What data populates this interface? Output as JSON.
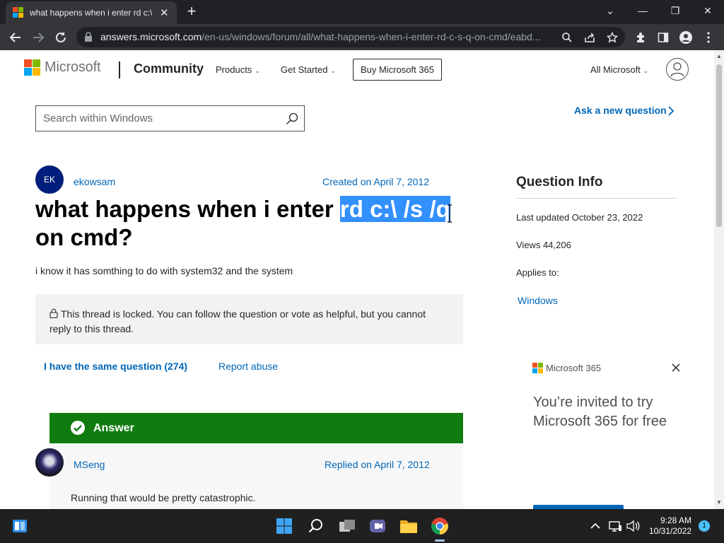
{
  "browser": {
    "tab_title": "what happens when i enter rd c:\\ /s /q on cmd",
    "tab_close": "✕",
    "new_tab": "+",
    "url_host": "answers.microsoft.com",
    "url_path": "/en-us/windows/forum/all/what-happens-when-i-enter-rd-c-s-q-on-cmd/eabd...",
    "window_controls": [
      "⌄",
      "—",
      "❐",
      "✕"
    ]
  },
  "header": {
    "brand": "Microsoft",
    "community": "Community",
    "nav": [
      "Products",
      "Get Started"
    ],
    "buy_button": "Buy Microsoft 365",
    "all_microsoft": "All Microsoft"
  },
  "search": {
    "placeholder": "Search within Windows"
  },
  "ask_question": "Ask a new question",
  "question": {
    "avatar_initials": "EK",
    "author": "ekowsam",
    "created": "Created on April 7, 2012",
    "title_before": "what happens when i enter ",
    "title_selected": "rd c:\\ /s /q",
    "title_after": " on cmd?",
    "body": "i know it has somthing to do with system32 and the system",
    "locked_notice": "This thread is locked. You can follow the question or vote as helpful, but you cannot reply to this thread.",
    "same_question": "I have the same question (274)",
    "report_abuse": "Report abuse"
  },
  "answer": {
    "label": "Answer",
    "author": "MSeng",
    "replied": "Replied on April 7, 2012",
    "text": "Running that would be pretty catastrophic."
  },
  "question_info": {
    "title": "Question Info",
    "last_updated": "Last updated October 23, 2022",
    "views": "Views 44,206",
    "applies_to": "Applies to:",
    "applies_link": "Windows"
  },
  "ad": {
    "brand": "Microsoft 365",
    "text": "You’re invited to try Microsoft 365 for free"
  },
  "taskbar": {
    "time": "9:28 AM",
    "date": "10/31/2022",
    "notification_count": "1"
  },
  "colors": {
    "ms_red": "#f25022",
    "ms_green": "#7fba00",
    "ms_blue": "#00a4ef",
    "ms_yellow": "#ffb900",
    "link_blue": "#0067b8",
    "answer_green": "#107c10",
    "selection": "#3390ff"
  },
  "icons": [
    "microsoft-logo",
    "back-arrow-icon",
    "forward-arrow-icon",
    "reload-icon",
    "lock-icon",
    "search-icon",
    "share-icon",
    "star-icon",
    "extensions-icon",
    "sidepanel-icon",
    "profile-icon",
    "menu-icon",
    "chevron-down-icon",
    "user-icon",
    "chevron-right-icon",
    "check-icon",
    "close-icon",
    "windows-start-icon",
    "taskbar-search-icon",
    "task-view-icon",
    "teams-icon",
    "file-explorer-icon",
    "chrome-icon",
    "wifi-icon",
    "volume-icon"
  ]
}
